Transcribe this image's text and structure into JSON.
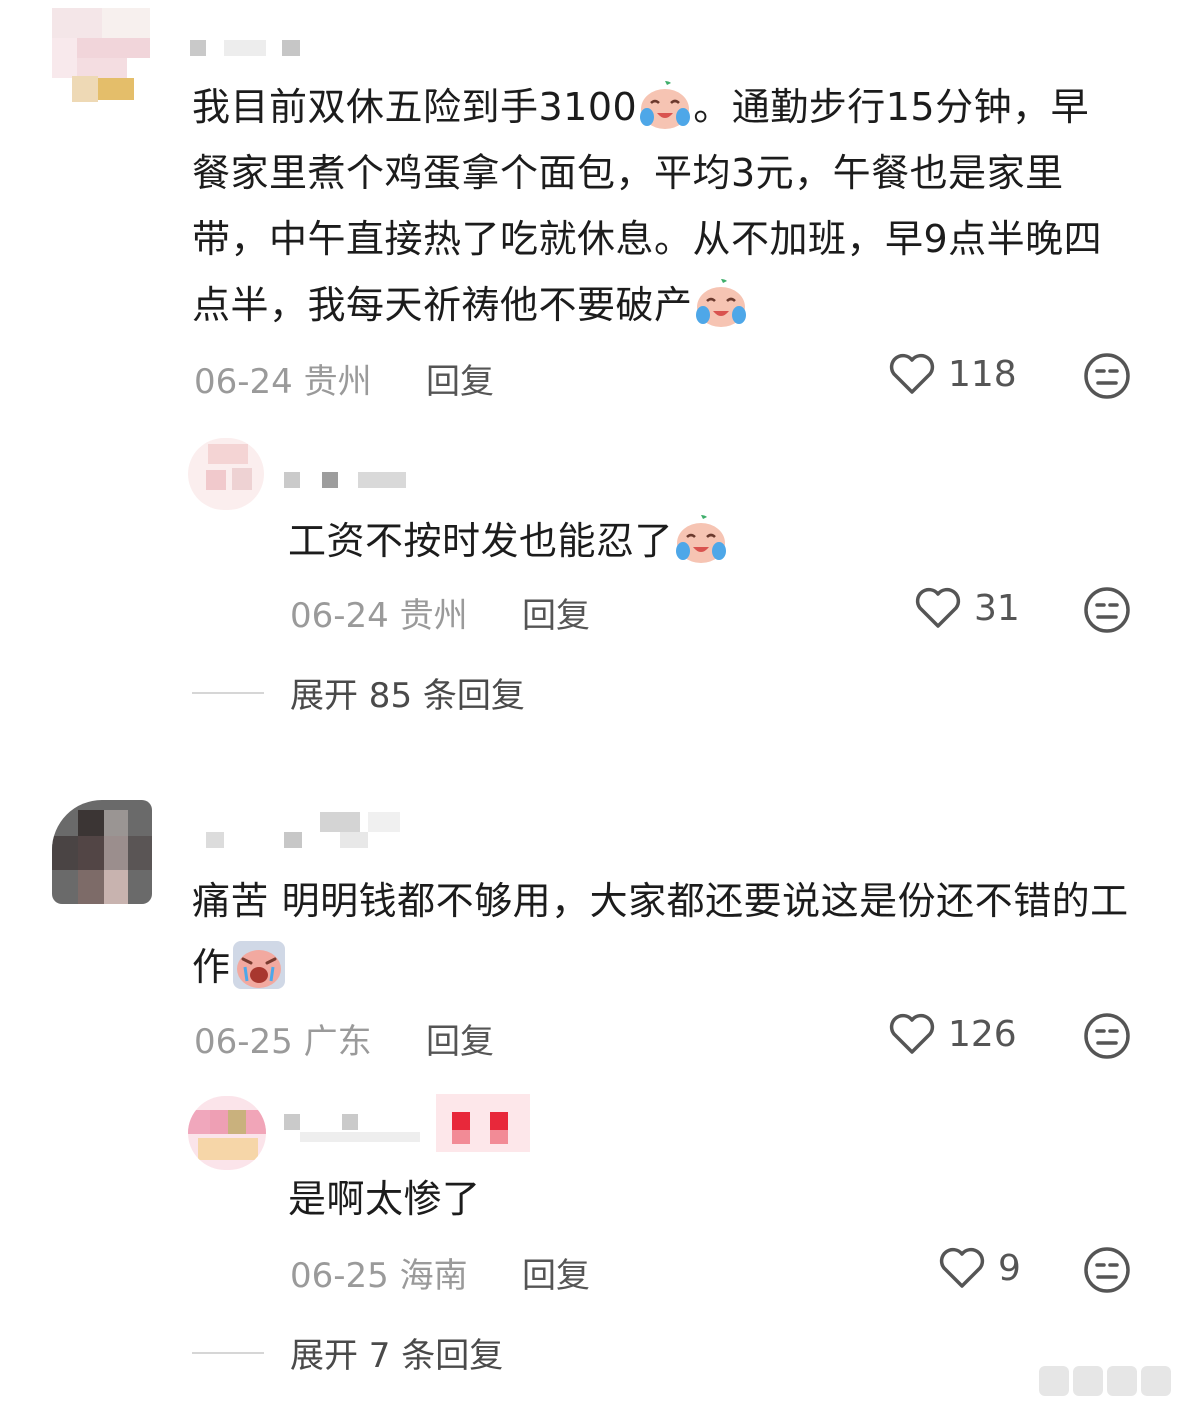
{
  "comments": [
    {
      "text_parts": [
        "我目前双休五险到手3100",
        "。通勤步行15分钟，早餐家里煮个鸡蛋拿个面包，平均3元，午餐也是家里带，中午直接热了吃就休息。从不加班，早9点半晚四点半，我每天祈祷他不要破产"
      ],
      "date": "06-24",
      "location": "贵州",
      "reply_label": "回复",
      "likes": "118",
      "emoji_name": "crying-laugh-emoji",
      "reply": {
        "text": "工资不按时发也能忍了",
        "date": "06-24",
        "location": "贵州",
        "reply_label": "回复",
        "likes": "31",
        "emoji_name": "crying-laugh-emoji"
      },
      "expand_label": "展开 85 条回复"
    },
    {
      "text": "痛苦 明明钱都不够用，大家都还要说这是份还不错的工作",
      "date": "06-25",
      "location": "广东",
      "reply_label": "回复",
      "likes": "126",
      "emoji_name": "wailing-emoji",
      "reply": {
        "text": "是啊太惨了",
        "date": "06-25",
        "location": "海南",
        "reply_label": "回复",
        "likes": "9"
      },
      "expand_label": "展开 7 条回复"
    }
  ],
  "colors": {
    "text": "#1c1c1c",
    "meta": "#9a9a9a",
    "icon": "#555555"
  }
}
